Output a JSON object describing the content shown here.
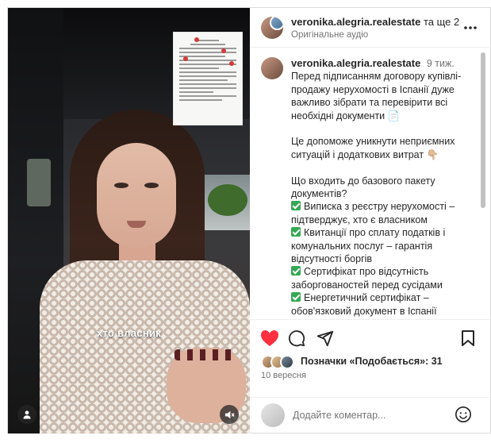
{
  "header": {
    "username": "veronika.alegria.realestate",
    "collab_suffix": "та ще 2",
    "audio": "Оригінальне аудіо",
    "more_icon": "more-horizontal-icon"
  },
  "caption": {
    "username": "veronika.alegria.realestate",
    "time_ago": "9 тиж.",
    "lines": [
      "Перед підписанням договору купівлі-",
      "продажу нерухомості в Іспанії дуже",
      "важливо зібрати та перевірити всі",
      "необхідні документи 📄",
      "",
      "Це допоможе уникнути неприємних",
      "ситуацій і додаткових витрат 👇🏼",
      "",
      "Що входить до базового пакету",
      "документів?",
      "✅ Виписка з реєстру нерухомості –",
      "підтверджує, хто є власником",
      "✅ Квитанції про сплату податків і",
      "комунальних послуг – гарантія",
      "відсутності боргів",
      "✅ Сертифікат про відсутність",
      "заборгованостей перед сусідами",
      "✅ Енергетичний сертифікат –",
      "обов'язковий документ в Іспанії"
    ]
  },
  "video": {
    "subtitle": "хто власник"
  },
  "actions": {
    "likes_prefix": "Позначки «Подобається»:",
    "likes_count": "31",
    "date": "10 вересня"
  },
  "comment": {
    "placeholder": "Додайте коментар..."
  },
  "colors": {
    "like_red": "#ff3040",
    "text": "#262626",
    "muted": "#737373",
    "check_green": "#34a853"
  }
}
